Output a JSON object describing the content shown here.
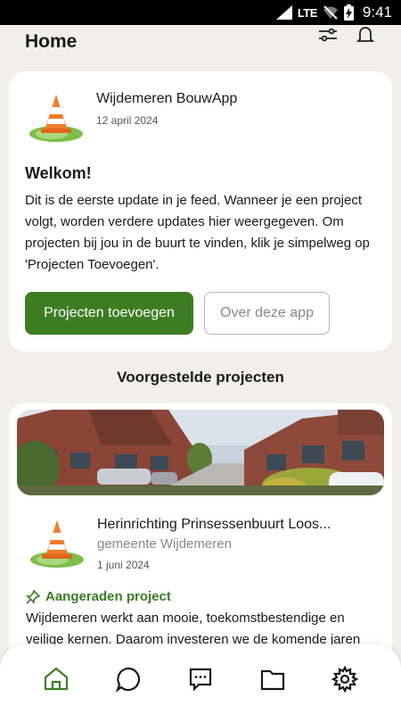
{
  "status_bar": {
    "network": "LTE",
    "time": "9:41"
  },
  "header": {
    "title": "Home",
    "filter_icon": "sliders-icon",
    "notifications_icon": "bell-icon"
  },
  "welcome": {
    "app_name": "Wijdemeren BouwApp",
    "date": "12 april 2024",
    "title": "Welkom!",
    "body": "Dit is de eerste update in je feed. Wanneer je een project volgt, worden verdere updates hier weergegeven. Om projecten bij jou in de buurt te vinden, klik je simpelweg op 'Projecten Toevoegen'.",
    "primary_button": "Projecten toevoegen",
    "secondary_button": "Over deze app"
  },
  "suggested": {
    "section_title": "Voorgestelde projecten",
    "project": {
      "title": "Herinrichting Prinsessenbuurt Loos...",
      "organization": "gemeente Wijdemeren",
      "date": "1 juni 2024",
      "tag": "Aangeraden project",
      "body": "Wijdemeren werkt aan mooie, toekomstbestendige en veilige kernen. Daarom investeren we de komende jaren"
    }
  },
  "bottom_nav": {
    "items": [
      {
        "icon": "home-icon",
        "active": true
      },
      {
        "icon": "chat-icon",
        "active": false
      },
      {
        "icon": "message-icon",
        "active": false
      },
      {
        "icon": "folder-icon",
        "active": false
      },
      {
        "icon": "settings-icon",
        "active": false
      }
    ]
  },
  "colors": {
    "accent": "#3c7d22",
    "background": "#f1efeb",
    "card": "#ffffff"
  }
}
